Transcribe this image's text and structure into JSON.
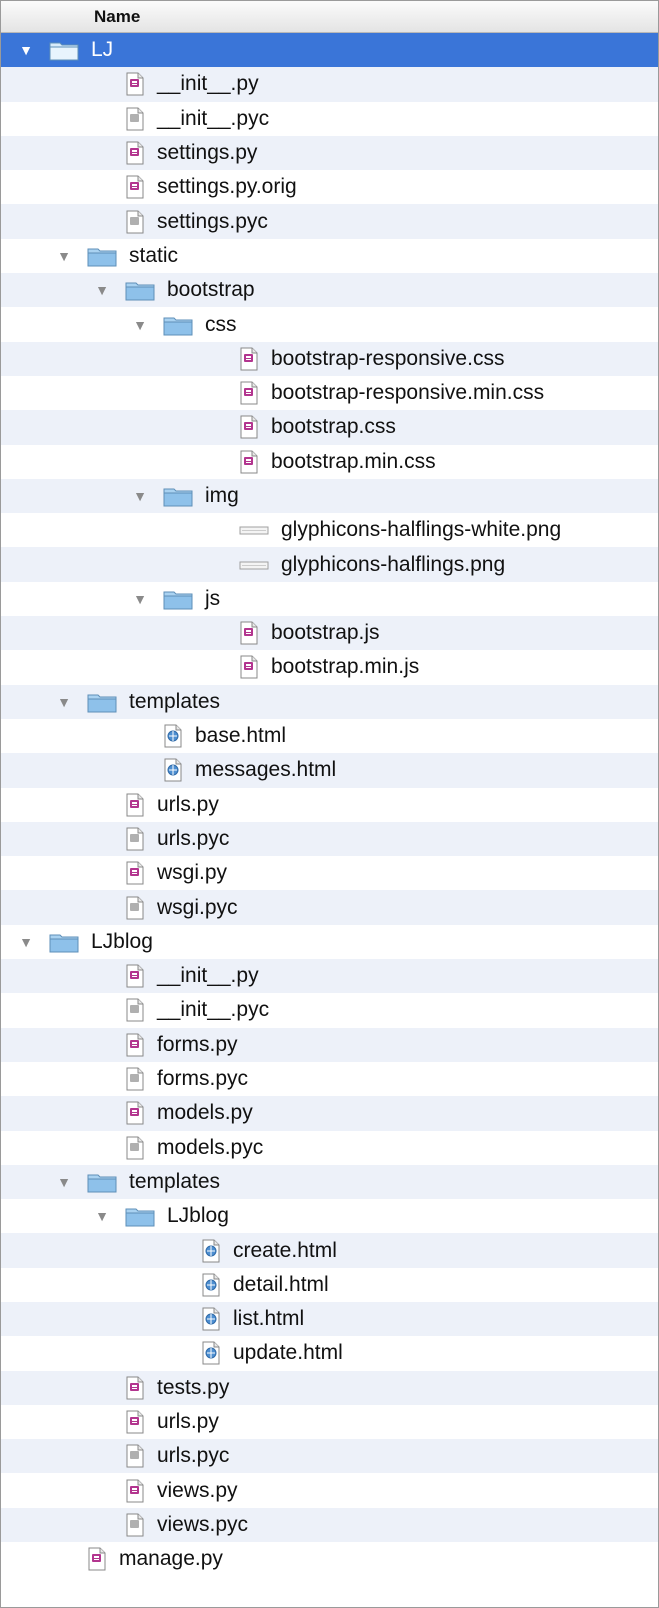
{
  "header": {
    "name_column": "Name"
  },
  "tree": [
    {
      "label": "LJ",
      "depth": 0,
      "kind": "folder",
      "expanded": true,
      "selected": true
    },
    {
      "label": "__init__.py",
      "depth": 2,
      "kind": "py"
    },
    {
      "label": "__init__.pyc",
      "depth": 2,
      "kind": "pyc"
    },
    {
      "label": "settings.py",
      "depth": 2,
      "kind": "py"
    },
    {
      "label": "settings.py.orig",
      "depth": 2,
      "kind": "py"
    },
    {
      "label": "settings.pyc",
      "depth": 2,
      "kind": "pyc"
    },
    {
      "label": "static",
      "depth": 1,
      "kind": "folder",
      "expanded": true
    },
    {
      "label": "bootstrap",
      "depth": 2,
      "kind": "folder",
      "expanded": true
    },
    {
      "label": "css",
      "depth": 3,
      "kind": "folder",
      "expanded": true
    },
    {
      "label": "bootstrap-responsive.css",
      "depth": 5,
      "kind": "css"
    },
    {
      "label": "bootstrap-responsive.min.css",
      "depth": 5,
      "kind": "css"
    },
    {
      "label": "bootstrap.css",
      "depth": 5,
      "kind": "css"
    },
    {
      "label": "bootstrap.min.css",
      "depth": 5,
      "kind": "css"
    },
    {
      "label": "img",
      "depth": 3,
      "kind": "folder",
      "expanded": true
    },
    {
      "label": "glyphicons-halflings-white.png",
      "depth": 5,
      "kind": "png"
    },
    {
      "label": "glyphicons-halflings.png",
      "depth": 5,
      "kind": "png"
    },
    {
      "label": "js",
      "depth": 3,
      "kind": "folder",
      "expanded": true
    },
    {
      "label": "bootstrap.js",
      "depth": 5,
      "kind": "js"
    },
    {
      "label": "bootstrap.min.js",
      "depth": 5,
      "kind": "js"
    },
    {
      "label": "templates",
      "depth": 1,
      "kind": "folder",
      "expanded": true
    },
    {
      "label": "base.html",
      "depth": 3,
      "kind": "html"
    },
    {
      "label": "messages.html",
      "depth": 3,
      "kind": "html"
    },
    {
      "label": "urls.py",
      "depth": 2,
      "kind": "py"
    },
    {
      "label": "urls.pyc",
      "depth": 2,
      "kind": "pyc"
    },
    {
      "label": "wsgi.py",
      "depth": 2,
      "kind": "py"
    },
    {
      "label": "wsgi.pyc",
      "depth": 2,
      "kind": "pyc"
    },
    {
      "label": "LJblog",
      "depth": 0,
      "kind": "folder",
      "expanded": true
    },
    {
      "label": "__init__.py",
      "depth": 2,
      "kind": "py"
    },
    {
      "label": "__init__.pyc",
      "depth": 2,
      "kind": "pyc"
    },
    {
      "label": "forms.py",
      "depth": 2,
      "kind": "py"
    },
    {
      "label": "forms.pyc",
      "depth": 2,
      "kind": "pyc"
    },
    {
      "label": "models.py",
      "depth": 2,
      "kind": "py"
    },
    {
      "label": "models.pyc",
      "depth": 2,
      "kind": "pyc"
    },
    {
      "label": "templates",
      "depth": 1,
      "kind": "folder",
      "expanded": true
    },
    {
      "label": "LJblog",
      "depth": 2,
      "kind": "folder",
      "expanded": true
    },
    {
      "label": "create.html",
      "depth": 4,
      "kind": "html"
    },
    {
      "label": "detail.html",
      "depth": 4,
      "kind": "html"
    },
    {
      "label": "list.html",
      "depth": 4,
      "kind": "html"
    },
    {
      "label": "update.html",
      "depth": 4,
      "kind": "html"
    },
    {
      "label": "tests.py",
      "depth": 2,
      "kind": "py"
    },
    {
      "label": "urls.py",
      "depth": 2,
      "kind": "py"
    },
    {
      "label": "urls.pyc",
      "depth": 2,
      "kind": "pyc"
    },
    {
      "label": "views.py",
      "depth": 2,
      "kind": "py"
    },
    {
      "label": "views.pyc",
      "depth": 2,
      "kind": "pyc"
    },
    {
      "label": "manage.py",
      "depth": 1,
      "kind": "py"
    }
  ],
  "colors": {
    "selection": "#3a75d8",
    "alternate_row": "#edf1f9",
    "folder": "#8ec1ea",
    "disclosure": "#8a8a8a"
  }
}
